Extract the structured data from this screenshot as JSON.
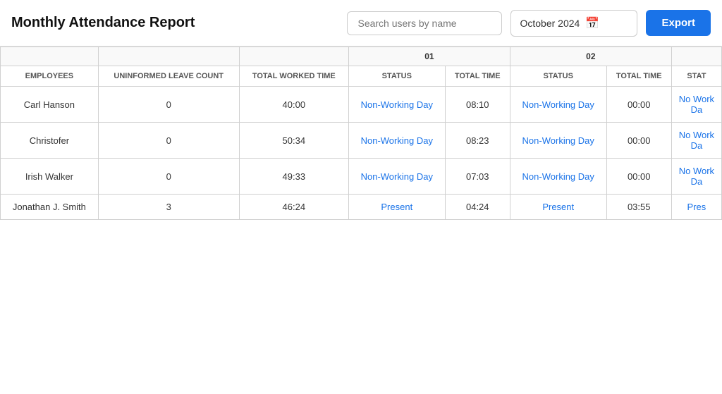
{
  "header": {
    "title": "Monthly Attendance Report",
    "search_placeholder": "Search users by name",
    "date_value": "October 2024",
    "export_label": "Export"
  },
  "table": {
    "col_groups": [
      {
        "label": "",
        "colspan": 3
      },
      {
        "label": "01",
        "colspan": 2
      },
      {
        "label": "02",
        "colspan": 2
      },
      {
        "label": "",
        "colspan": 1
      }
    ],
    "columns": [
      {
        "key": "employees",
        "label": "EMPLOYEES"
      },
      {
        "key": "uninformed_leave_count",
        "label": "UNINFORMED LEAVE COUNT"
      },
      {
        "key": "total_worked_time",
        "label": "TOTAL WORKED TIME"
      },
      {
        "key": "day01_status",
        "label": "STATUS"
      },
      {
        "key": "day01_total_time",
        "label": "TOTAL TIME"
      },
      {
        "key": "day02_status",
        "label": "STATUS"
      },
      {
        "key": "day02_total_time",
        "label": "TOTAL TIME"
      },
      {
        "key": "day03_status",
        "label": "STAT"
      }
    ],
    "rows": [
      {
        "employees": "Carl Hanson",
        "uninformed_leave_count": "0",
        "total_worked_time": "40:00",
        "day01_status": "Non-Working Day",
        "day01_total_time": "08:10",
        "day02_status": "Non-Working Day",
        "day02_total_time": "00:00",
        "day03_status": "No Work Da"
      },
      {
        "employees": "Christofer",
        "uninformed_leave_count": "0",
        "total_worked_time": "50:34",
        "day01_status": "Non-Working Day",
        "day01_total_time": "08:23",
        "day02_status": "Non-Working Day",
        "day02_total_time": "00:00",
        "day03_status": "No Work Da"
      },
      {
        "employees": "Irish Walker",
        "uninformed_leave_count": "0",
        "total_worked_time": "49:33",
        "day01_status": "Non-Working Day",
        "day01_total_time": "07:03",
        "day02_status": "Non-Working Day",
        "day02_total_time": "00:00",
        "day03_status": "No Work Da"
      },
      {
        "employees": "Jonathan J. Smith",
        "uninformed_leave_count": "3",
        "total_worked_time": "46:24",
        "day01_status": "Present",
        "day01_total_time": "04:24",
        "day02_status": "Present",
        "day02_total_time": "03:55",
        "day03_status": "Pres"
      }
    ]
  }
}
